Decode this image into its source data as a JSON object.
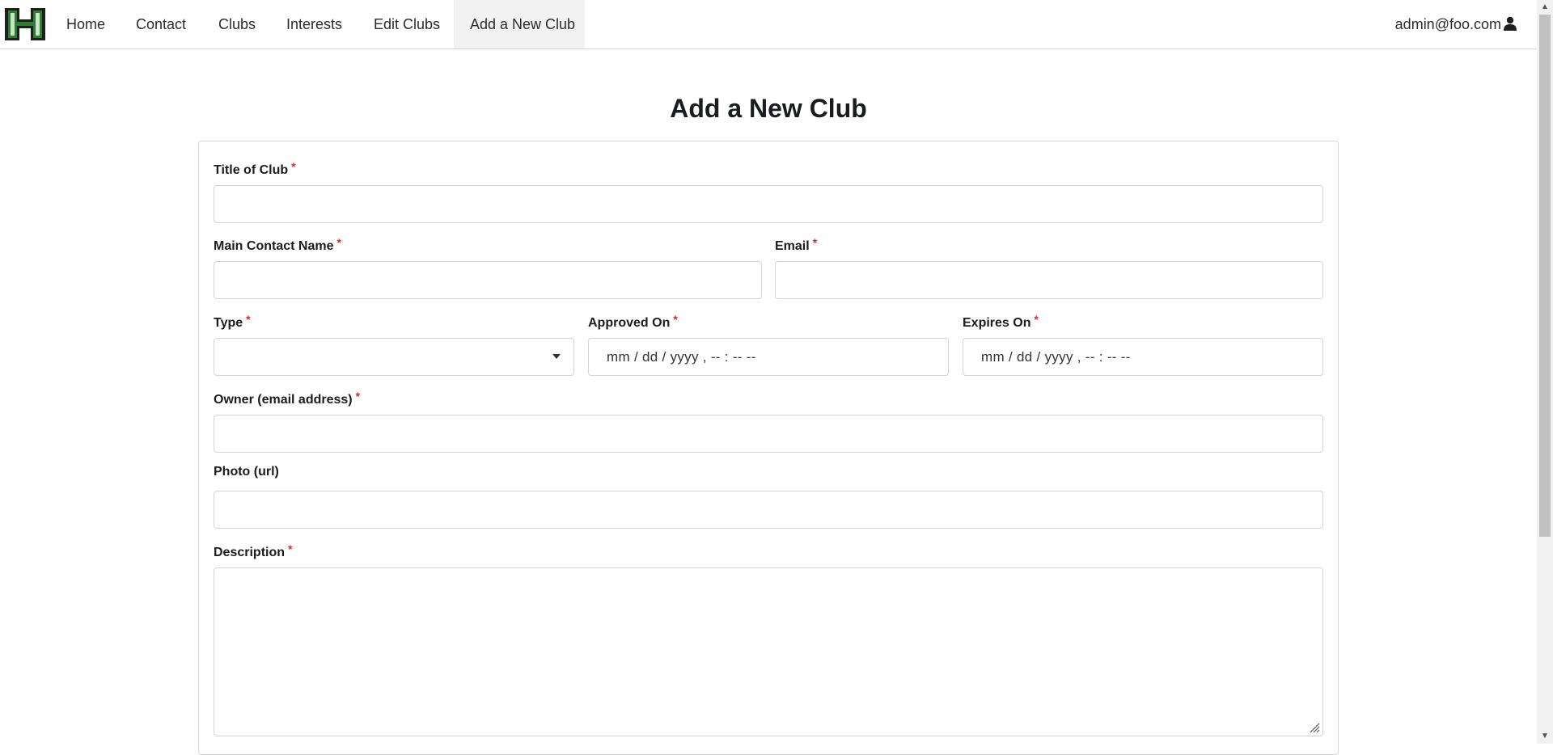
{
  "nav": {
    "items": [
      {
        "label": "Home"
      },
      {
        "label": "Contact"
      },
      {
        "label": "Clubs"
      },
      {
        "label": "Interests"
      },
      {
        "label": "Edit Clubs"
      },
      {
        "label": "Add a New Club",
        "active": true
      }
    ],
    "user_email": "admin@foo.com",
    "logo_icon": "h-logo-icon",
    "user_icon": "user-icon"
  },
  "page": {
    "title": "Add a New Club"
  },
  "form": {
    "required_marker": "*",
    "title_label": "Title of Club",
    "contact_label": "Main Contact Name",
    "email_label": "Email",
    "type_label": "Type",
    "approved_label": "Approved On",
    "expires_label": "Expires On",
    "owner_label": "Owner (email address)",
    "photo_label": "Photo (url)",
    "description_label": "Description",
    "date_placeholder": "mm / dd / yyyy ,  -- : --   --"
  },
  "colors": {
    "accent_green": "#2e7d32",
    "required_red": "#db2828",
    "active_tab_bg": "#f2f2f2"
  }
}
